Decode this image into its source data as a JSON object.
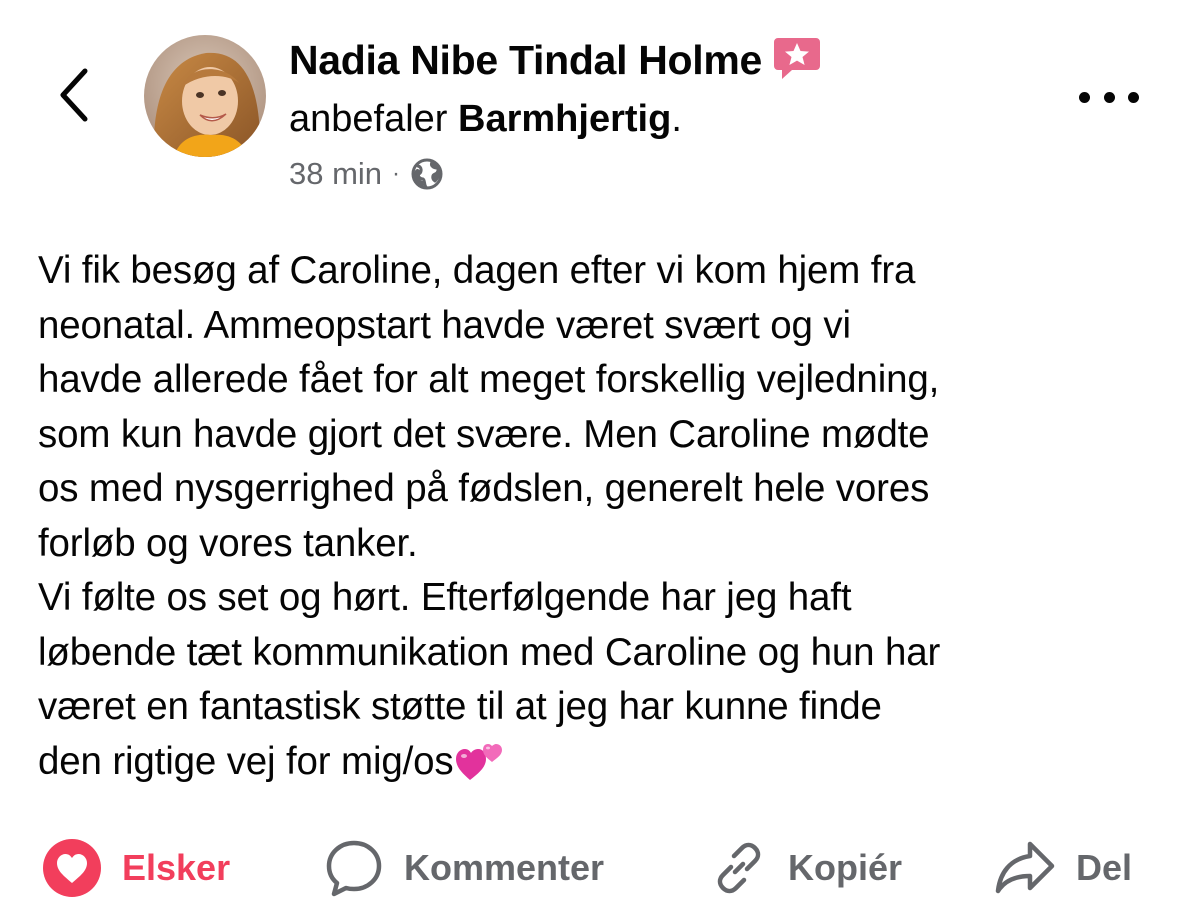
{
  "header": {
    "back_icon": "chevron-left-icon",
    "author_name": "Nadia Nibe Tindal Holme",
    "badge_icon": "recommend-star-icon",
    "recommend_verb": "anbefaler",
    "recommend_target": "Barmhjertig",
    "recommend_end": ".",
    "time": "38 min",
    "separator": "·",
    "audience_icon": "globe-icon",
    "more_icon": "more-dots-icon"
  },
  "post": {
    "paragraph_1": "Vi fik besøg af Caroline, dagen efter vi kom hjem fra\nneonatal. Ammeopstart havde været svært og vi\nhavde allerede fået for alt meget forskellig vejledning,\nsom kun havde gjort det svære. Men Caroline mødte\nos med nysgerrighed på fødslen, generelt hele vores\nforløb og vores tanker.",
    "paragraph_2": "Vi følte os set og hørt. Efterfølgende har jeg haft\nløbende tæt kommunikation med Caroline og hun har\nværet en fantastisk støtte til at jeg har kunne finde\nden rigtige vej for mig/os",
    "emoji": "two-hearts-emoji"
  },
  "actions": {
    "love_label": "Elsker",
    "comment_label": "Kommenter",
    "copy_label": "Kopiér",
    "share_label": "Del"
  },
  "colors": {
    "love_red": "#f23e5c",
    "secondary_text": "#65676b",
    "primary_text": "#050505",
    "badge_pink": "#e8698c"
  }
}
